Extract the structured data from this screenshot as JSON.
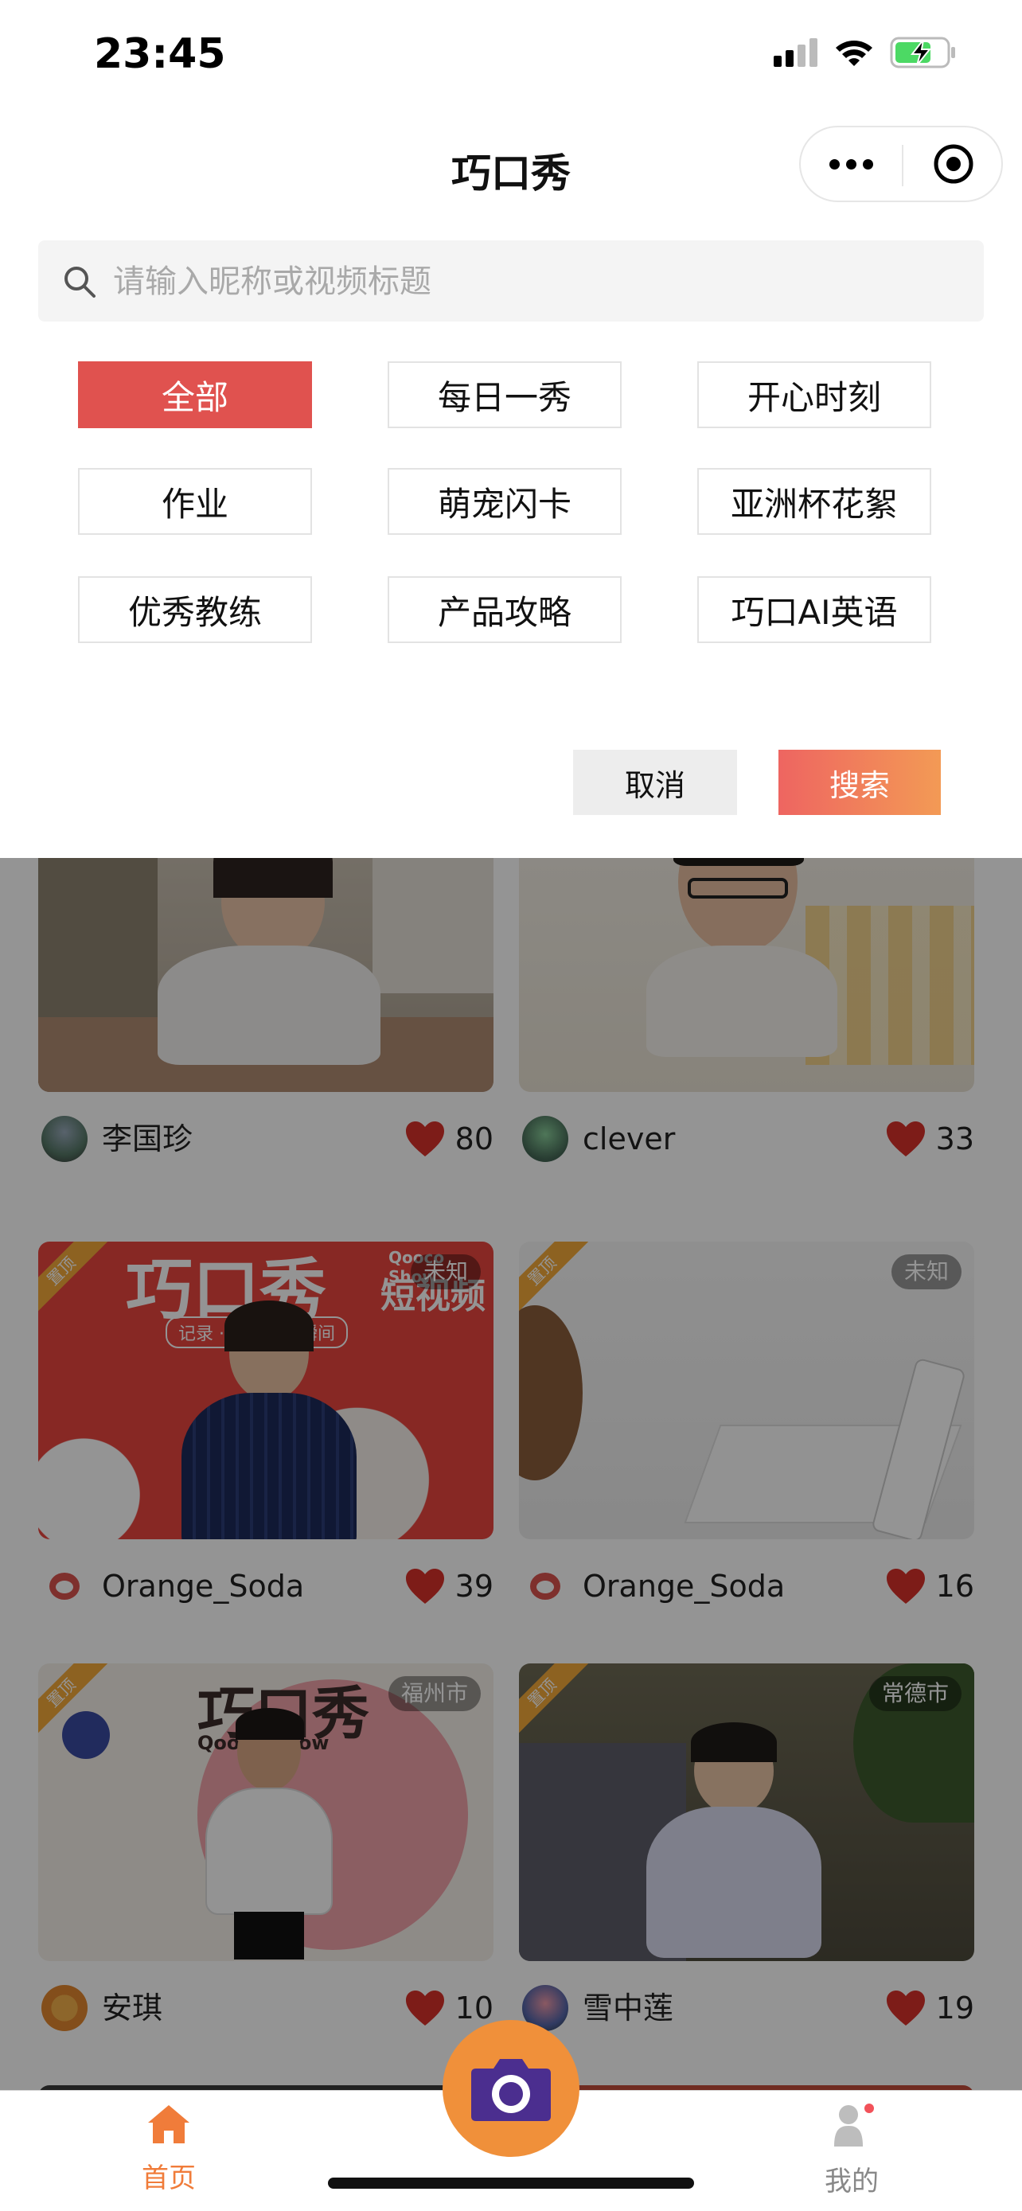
{
  "status": {
    "time": "23:45"
  },
  "nav": {
    "title": "巧口秀"
  },
  "search": {
    "placeholder": "请输入昵称或视频标题"
  },
  "categories": [
    "全部",
    "每日一秀",
    "开心时刻",
    "作业",
    "萌宠闪卡",
    "亚洲杯花絮",
    "优秀教练",
    "产品攻略",
    "巧口AI英语"
  ],
  "actions": {
    "cancel": "取消",
    "search": "搜索"
  },
  "feed": [
    {
      "name": "李国珍",
      "likes": "80",
      "location": "",
      "badge": ""
    },
    {
      "name": "clever",
      "likes": "33",
      "location": "",
      "badge": ""
    },
    {
      "name": "Orange_Soda",
      "likes": "39",
      "location": "未知",
      "badge": "置顶",
      "poster_title": "巧口秀",
      "poster_brand": "Qooco Show",
      "poster_sub": "短视频",
      "poster_tag": "记录 · 分享蜕变瞬间"
    },
    {
      "name": "Orange_Soda",
      "likes": "16",
      "location": "未知",
      "badge": "置顶"
    },
    {
      "name": "安琪",
      "likes": "10",
      "location": "福州市",
      "badge": "置顶",
      "poster_title": "巧口秀",
      "poster_brand": "Qooco Show"
    },
    {
      "name": "雪中莲",
      "likes": "19",
      "location": "常德市",
      "badge": "置顶"
    }
  ],
  "tabbar": {
    "home": "首页",
    "mine": "我的"
  },
  "colors": {
    "accent": "#e0524f",
    "orange": "#f0903a",
    "heart": "#d8312a"
  }
}
